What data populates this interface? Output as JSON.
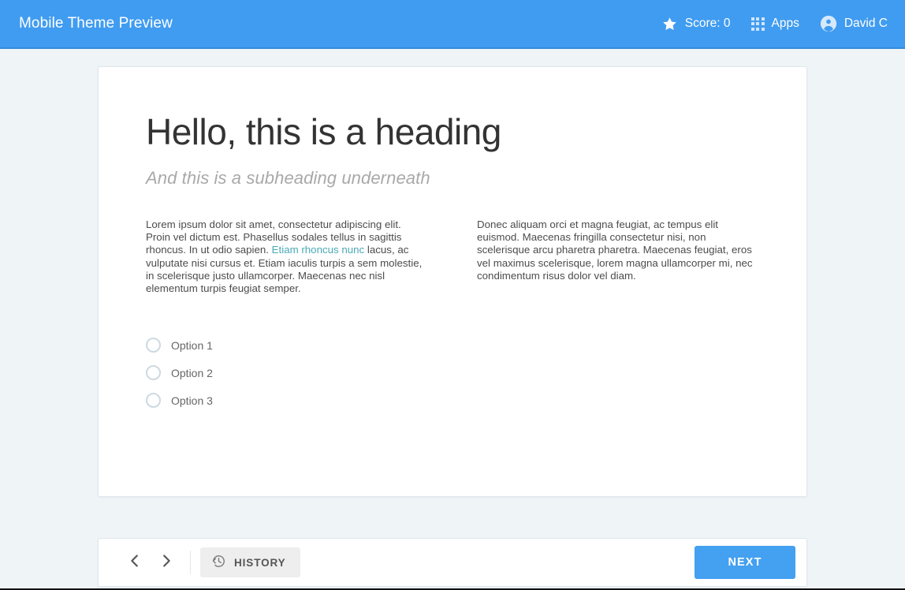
{
  "header": {
    "title": "Mobile Theme Preview",
    "brand_color": "#409cf0",
    "items": [
      {
        "icon": "star-icon",
        "label": "Score: 0"
      },
      {
        "icon": "apps-grid-icon",
        "label": "Apps"
      },
      {
        "icon": "account-circle-icon",
        "label": "David C"
      }
    ]
  },
  "content": {
    "heading": "Hello, this is a heading",
    "subheading": "And this is a subheading underneath",
    "paragraphs": {
      "left_before_link": "Lorem ipsum dolor sit amet, consectetur adipiscing elit. Proin vel dictum est. Phasellus sodales tellus in sagittis rhoncus. In ut odio sapien. ",
      "left_link": "Etiam rhoncus nunc",
      "left_after_link": " lacus, ac vulputate nisi cursus et. Etiam iaculis turpis a sem molestie, in scelerisque justo ullamcorper. Maecenas nec nisl elementum turpis feugiat semper.",
      "right": "Donec aliquam orci et magna feugiat, ac tempus elit euismod. Maecenas fringilla consectetur nisi, non scelerisque arcu pharetra pharetra. Maecenas feugiat, eros vel maximus scelerisque, lorem magna ullamcorper mi, nec condimentum risus dolor vel diam."
    },
    "link_color": "#4aa9b6",
    "options": [
      {
        "label": "Option 1",
        "selected": false
      },
      {
        "label": "Option 2",
        "selected": false
      },
      {
        "label": "Option 3",
        "selected": false
      }
    ]
  },
  "toolbar": {
    "prev_icon": "chevron-left-icon",
    "next_icon": "chevron-right-icon",
    "history_label": "HISTORY",
    "history_icon": "history-clock-icon",
    "next_label": "NEXT",
    "next_color": "#44a0f0"
  }
}
